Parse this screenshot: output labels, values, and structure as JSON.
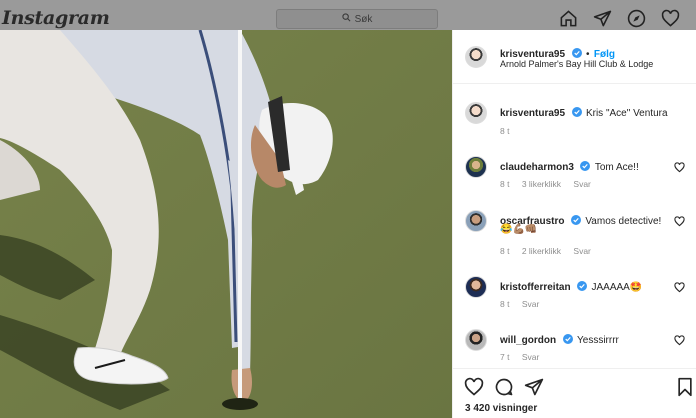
{
  "topbar": {
    "logo": "Instagram",
    "search_placeholder": "Søk",
    "nav_icons": [
      "home-icon",
      "direct-icon",
      "explore-icon",
      "heart-icon"
    ]
  },
  "post": {
    "author": "kristventura95",
    "follow_label": "Følg",
    "location": "Arnold Palmer's Bay Hill Club & Lodge",
    "caption_user": "krisventura95",
    "caption_text": "Kris \"Ace\" Ventura",
    "caption_time": "8 t",
    "views": "3 420 visninger"
  },
  "header": {
    "username": "krisventura95"
  },
  "comments": [
    {
      "user": "claudeharmon3",
      "text": "Tom Ace!!",
      "time": "8 t",
      "likes": "3 likerklikk",
      "reply": "Svar"
    },
    {
      "user": "oscarfraustro",
      "text": "Vamos detective!",
      "emojis": "😂💪🏽👊🏽",
      "time": "8 t",
      "likes": "2 likerklikk",
      "reply": "Svar"
    },
    {
      "user": "kristofferreitan",
      "text": "JAAAAA🤩",
      "time": "8 t",
      "reply": "Svar"
    },
    {
      "user": "will_gordon",
      "text": "Yesssirrrr",
      "time": "7 t",
      "reply": "Svar"
    }
  ],
  "colors": {
    "accent": "#0095f6",
    "verified": "#3897f0",
    "green": "#6e7a46"
  }
}
